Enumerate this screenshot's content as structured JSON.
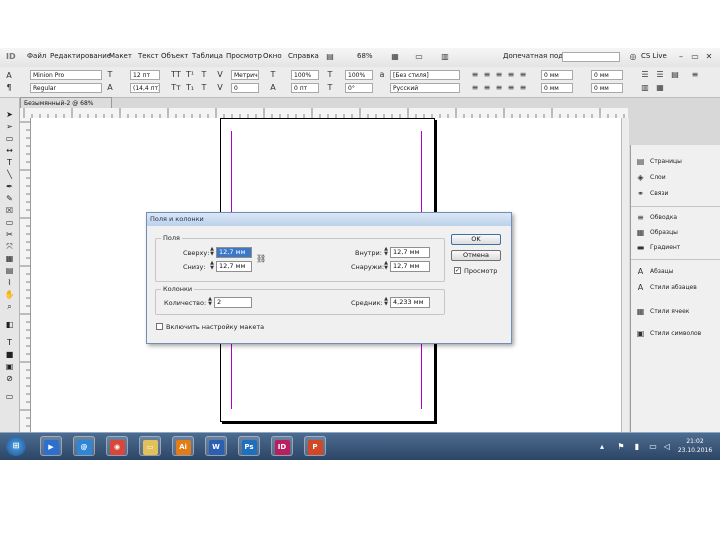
{
  "app": {
    "id": "ID",
    "menu": [
      "Файл",
      "Редактирование",
      "Макет",
      "Текст",
      "Объект",
      "Таблица",
      "Просмотр",
      "Окно",
      "Справка"
    ],
    "zoom": "68%",
    "workspace": "Допечатная подготовка",
    "cs_live": "CS Live"
  },
  "control_panel": {
    "font": "Minion Pro",
    "style": "Regular",
    "size": "12 пт",
    "leading": "(14,4 пт)",
    "kerning": "Метрич",
    "tracking": "0",
    "scale_v": "100%",
    "scale_h": "100%",
    "baseline": "0 пт",
    "skew": "0°",
    "char_style": "[Без стиля]",
    "language": "Русский",
    "indent_1": "0 мм",
    "indent_2": "0 мм",
    "indent_3": "0 мм",
    "indent_4": "0 мм"
  },
  "document": {
    "tab_label": "Безымянный-2 @ 68%"
  },
  "panel": {
    "items": [
      {
        "icon": "pages-icon",
        "glyph": "▤",
        "label": "Страницы"
      },
      {
        "icon": "layers-icon",
        "glyph": "◈",
        "label": "Слои"
      },
      {
        "icon": "links-icon",
        "glyph": "⚭",
        "label": "Связи"
      },
      {
        "icon": "stroke-icon",
        "glyph": "≡",
        "label": "Обводка"
      },
      {
        "icon": "swatches-icon",
        "glyph": "▦",
        "label": "Образцы"
      },
      {
        "icon": "gradient-icon",
        "glyph": "▬",
        "label": "Градиент"
      },
      {
        "icon": "character-icon",
        "glyph": "A",
        "label": "Абзацы"
      },
      {
        "icon": "char-styles-icon",
        "glyph": "A",
        "label": "Стили абзацев"
      },
      {
        "icon": "table-styles-icon",
        "glyph": "▦",
        "label": "Стили ячеек"
      },
      {
        "icon": "object-styles-icon",
        "glyph": "▣",
        "label": "Стили символов"
      }
    ]
  },
  "dialog": {
    "title": "Поля и колонки",
    "margins_group": "Поля",
    "top_label": "Сверху:",
    "top_value": "12,7 мм",
    "bottom_label": "Снизу:",
    "bottom_value": "12,7 мм",
    "inside_label": "Внутри:",
    "inside_value": "12,7 мм",
    "outside_label": "Снаружи:",
    "outside_value": "12,7 мм",
    "columns_group": "Колонки",
    "count_label": "Количество:",
    "count_value": "2",
    "gutter_label": "Средник:",
    "gutter_value": "4,233 мм",
    "ok_label": "OK",
    "cancel_label": "Отмена",
    "preview_label": "Просмотр",
    "preview_checked": true,
    "adjust_label": "Включить настройку макета"
  },
  "taskbar": {
    "apps": [
      {
        "name": "media-player-icon",
        "glyph": "▶",
        "color": "#2d6fcf"
      },
      {
        "name": "mail-icon",
        "glyph": "@",
        "color": "#2f86d6"
      },
      {
        "name": "chrome-icon",
        "glyph": "◉",
        "color": "#d9473a"
      },
      {
        "name": "folder-icon",
        "glyph": "▭",
        "color": "#e3c15a"
      },
      {
        "name": "illustrator-icon",
        "glyph": "Ai",
        "color": "#e37b16"
      },
      {
        "name": "word-icon",
        "glyph": "W",
        "color": "#2b5fb3"
      },
      {
        "name": "photoshop-icon",
        "glyph": "Ps",
        "color": "#1f6fbf"
      },
      {
        "name": "indesign-icon",
        "glyph": "ID",
        "color": "#b81f5f"
      },
      {
        "name": "powerpoint-icon",
        "glyph": "P",
        "color": "#d24726"
      }
    ],
    "time": "21:02",
    "date": "23.10.2016"
  }
}
